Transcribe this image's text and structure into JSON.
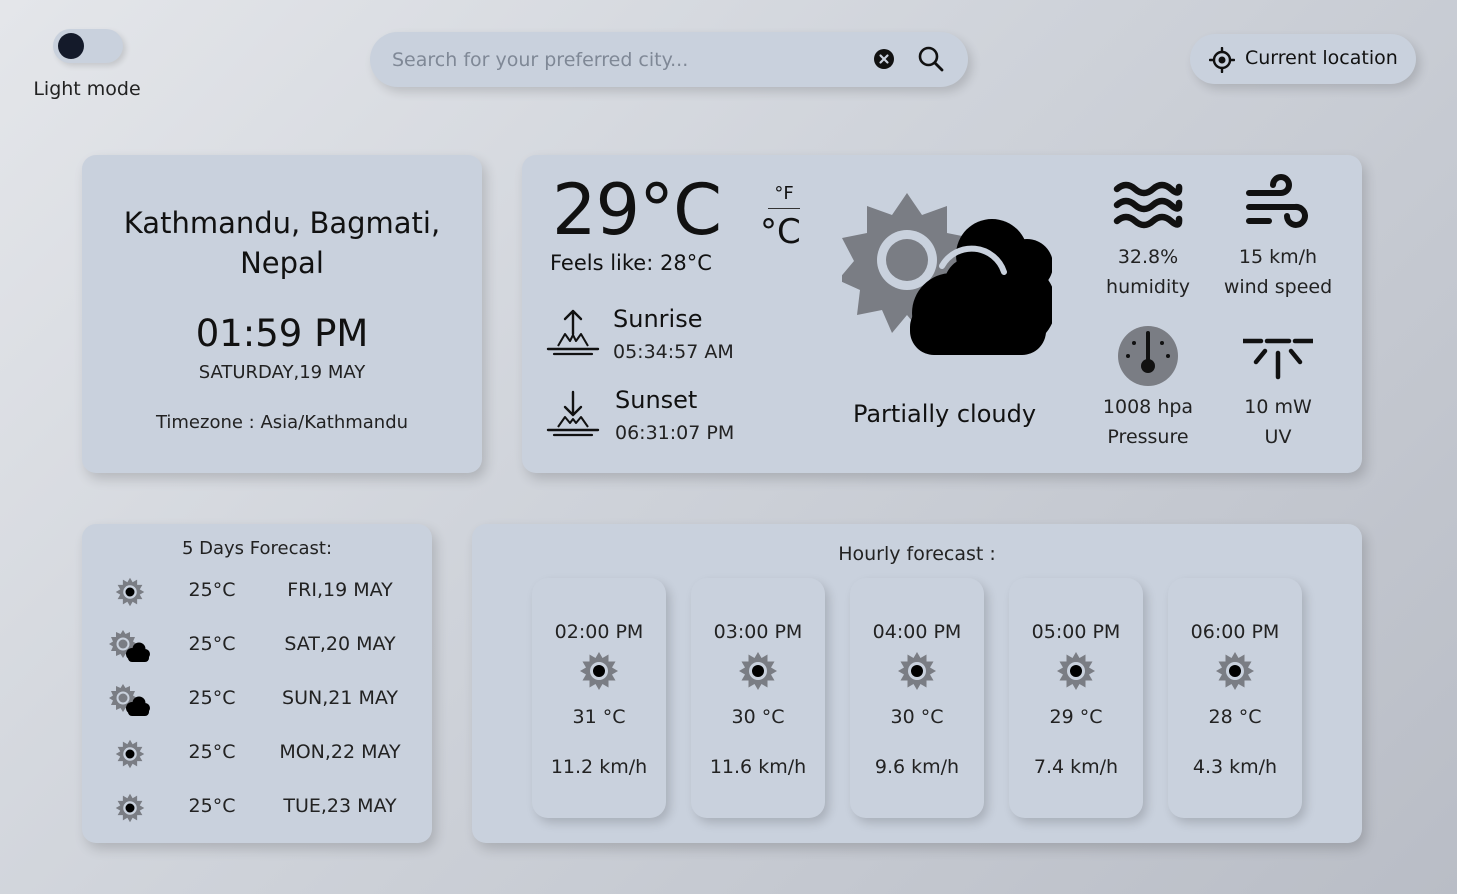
{
  "theme_toggle": {
    "label": "Light mode"
  },
  "search": {
    "placeholder": "Search for your preferred city..."
  },
  "location_button": {
    "label": "Current location"
  },
  "city": {
    "name": "Kathmandu, Bagmati, Nepal",
    "time": "01:59 PM",
    "date": "SATURDAY,19 MAY",
    "timezone": "Timezone : Asia/Kathmandu"
  },
  "current": {
    "temperature": "29°C",
    "unit_f": "°F",
    "unit_c": "°C",
    "feels_like": "Feels like: 28°C",
    "sunrise_label": "Sunrise",
    "sunrise_time": "05:34:57 AM",
    "sunset_label": "Sunset",
    "sunset_time": "06:31:07 PM",
    "condition": "Partially cloudy",
    "condition_icon": "partly-cloudy-icon",
    "humidity_value": "32.8%",
    "humidity_label": "humidity",
    "wind_value": "15 km/h",
    "wind_label": "wind speed",
    "pressure_value": "1008 hpa",
    "pressure_label": "Pressure",
    "uv_value": "10 mW",
    "uv_label": "UV"
  },
  "daily": {
    "title": "5 Days Forecast:",
    "days": [
      {
        "icon": "sun-icon",
        "temp": "25°C",
        "date": "FRI,19 MAY"
      },
      {
        "icon": "partly-cloudy-icon",
        "temp": "25°C",
        "date": "SAT,20 MAY"
      },
      {
        "icon": "partly-cloudy-icon",
        "temp": "25°C",
        "date": "SUN,21 MAY"
      },
      {
        "icon": "sun-icon",
        "temp": "25°C",
        "date": "MON,22 MAY"
      },
      {
        "icon": "sun-icon",
        "temp": "25°C",
        "date": "TUE,23 MAY"
      }
    ]
  },
  "hourly": {
    "title": "Hourly forecast :",
    "hours": [
      {
        "time": "02:00 PM",
        "icon": "sun-icon",
        "temp": "31 °C",
        "wind": "11.2 km/h"
      },
      {
        "time": "03:00 PM",
        "icon": "sun-icon",
        "temp": "30 °C",
        "wind": "11.6 km/h"
      },
      {
        "time": "04:00 PM",
        "icon": "sun-icon",
        "temp": "30 °C",
        "wind": "9.6 km/h"
      },
      {
        "time": "05:00 PM",
        "icon": "sun-icon",
        "temp": "29 °C",
        "wind": "7.4 km/h"
      },
      {
        "time": "06:00 PM",
        "icon": "sun-icon",
        "temp": "28 °C",
        "wind": "4.3 km/h"
      }
    ]
  },
  "colors": {
    "card": "#c9d1dd",
    "icon_gray": "#7a7d84",
    "knob": "#141a2a"
  }
}
